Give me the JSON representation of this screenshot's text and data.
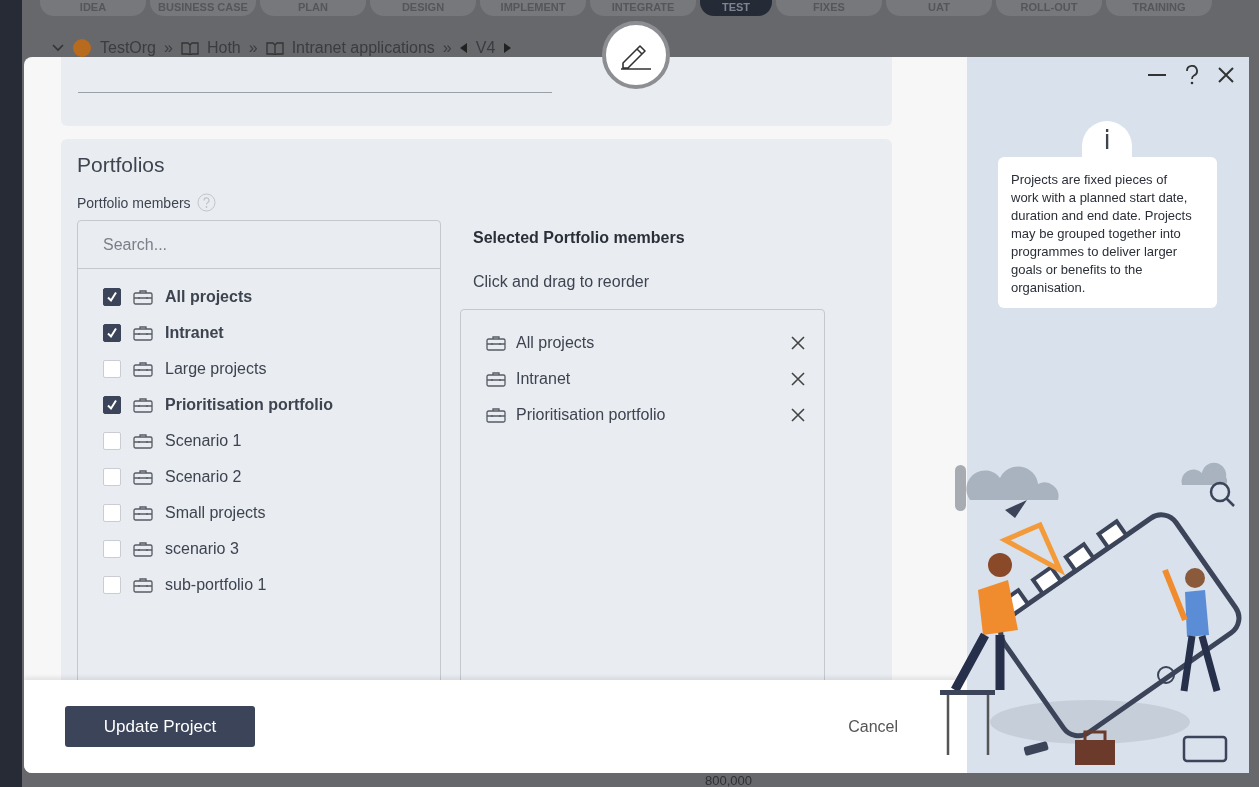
{
  "background": {
    "stage_tabs": [
      {
        "label": "IDEA",
        "selected": false
      },
      {
        "label": "BUSINESS CASE",
        "selected": false
      },
      {
        "label": "PLAN",
        "selected": false
      },
      {
        "label": "DESIGN",
        "selected": false
      },
      {
        "label": "IMPLEMENT",
        "selected": false
      },
      {
        "label": "INTEGRATE",
        "selected": false
      },
      {
        "label": "TEST",
        "selected": true
      },
      {
        "label": "FIXES",
        "selected": false
      },
      {
        "label": "UAT",
        "selected": false
      },
      {
        "label": "ROLL-OUT",
        "selected": false
      },
      {
        "label": "TRAINING",
        "selected": false
      }
    ],
    "breadcrumb": {
      "items": [
        "TestOrg",
        "Hoth",
        "Intranet applications"
      ],
      "separator": "»",
      "version": "V4"
    },
    "axis_label": "800,000"
  },
  "dialog": {
    "section_title": "Portfolios",
    "field_label": "Portfolio members",
    "search": {
      "placeholder": "Search..."
    },
    "members": [
      {
        "label": "All projects",
        "checked": true
      },
      {
        "label": "Intranet",
        "checked": true
      },
      {
        "label": "Large projects",
        "checked": false
      },
      {
        "label": "Prioritisation portfolio",
        "checked": true
      },
      {
        "label": "Scenario 1",
        "checked": false
      },
      {
        "label": "Scenario 2",
        "checked": false
      },
      {
        "label": "Small projects",
        "checked": false
      },
      {
        "label": "scenario 3",
        "checked": false
      },
      {
        "label": "sub-portfolio 1",
        "checked": false
      }
    ],
    "selected_title": "Selected Portfolio members",
    "selected_hint": "Click and drag to reorder",
    "selected_members": [
      {
        "label": "All projects"
      },
      {
        "label": "Intranet"
      },
      {
        "label": "Prioritisation portfolio"
      }
    ],
    "info_mark": "i",
    "info_text": "Projects are fixed pieces of work with a planned start date, duration and end date. Projects may be grouped together into programmes to deliver larger goals or benefits to the organisation.",
    "primary_button": "Update Project",
    "cancel_button": "Cancel"
  }
}
